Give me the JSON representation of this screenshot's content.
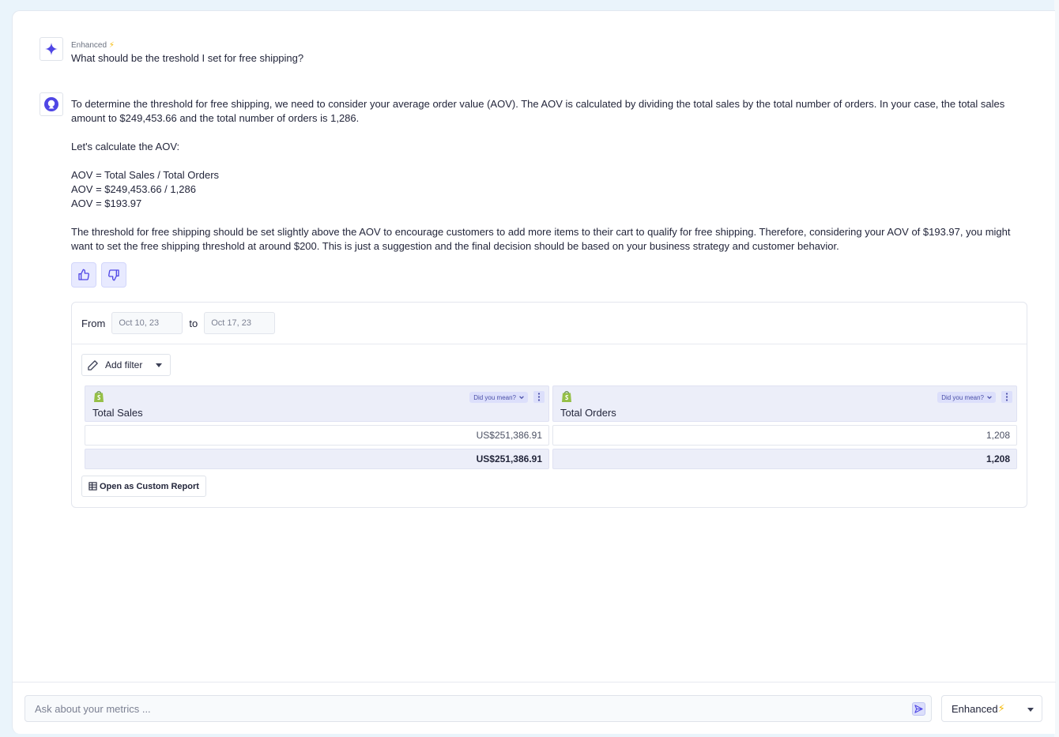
{
  "user_message": {
    "mode_tag": "Enhanced",
    "mode_tag_bolt": "⚡",
    "question": "What should be the treshold I set for free shipping?"
  },
  "bot_message": {
    "paragraphs": [
      "To determine the threshold for free shipping, we need to consider your average order value (AOV). The AOV is calculated by dividing the total sales by the total number of orders. In your case, the total sales amount to $249,453.66 and the total number of orders is 1,286.",
      "Let's calculate the AOV:"
    ],
    "formula_lines": [
      "AOV = Total Sales / Total Orders",
      "AOV = $249,453.66 / 1,286",
      "AOV = $193.97"
    ],
    "conclusion": "The threshold for free shipping should be set slightly above the AOV to encourage customers to add more items to their cart to qualify for free shipping. Therefore, considering your AOV of $193.97, you might want to set the free shipping threshold at around $200. This is just a suggestion and the final decision should be based on your business strategy and customer behavior."
  },
  "report": {
    "from_label": "From",
    "from_value": "Oct 10, 23",
    "to_label": "to",
    "to_value": "Oct 17, 23",
    "add_filter_label": "Add filter",
    "did_you_mean_label": "Did you mean?",
    "columns": [
      {
        "title": "Total Sales",
        "value": "US$251,386.91",
        "total": "US$251,386.91"
      },
      {
        "title": "Total Orders",
        "value": "1,208",
        "total": "1,208"
      }
    ],
    "open_button_label": "Open as Custom Report"
  },
  "composer": {
    "placeholder": "Ask about your metrics ...",
    "mode_label": "Enhanced",
    "mode_bolt": "⚡"
  },
  "colors": {
    "accent": "#4f46e5",
    "shopify_green": "#95bf47",
    "highlight_bg": "#eceef9"
  }
}
